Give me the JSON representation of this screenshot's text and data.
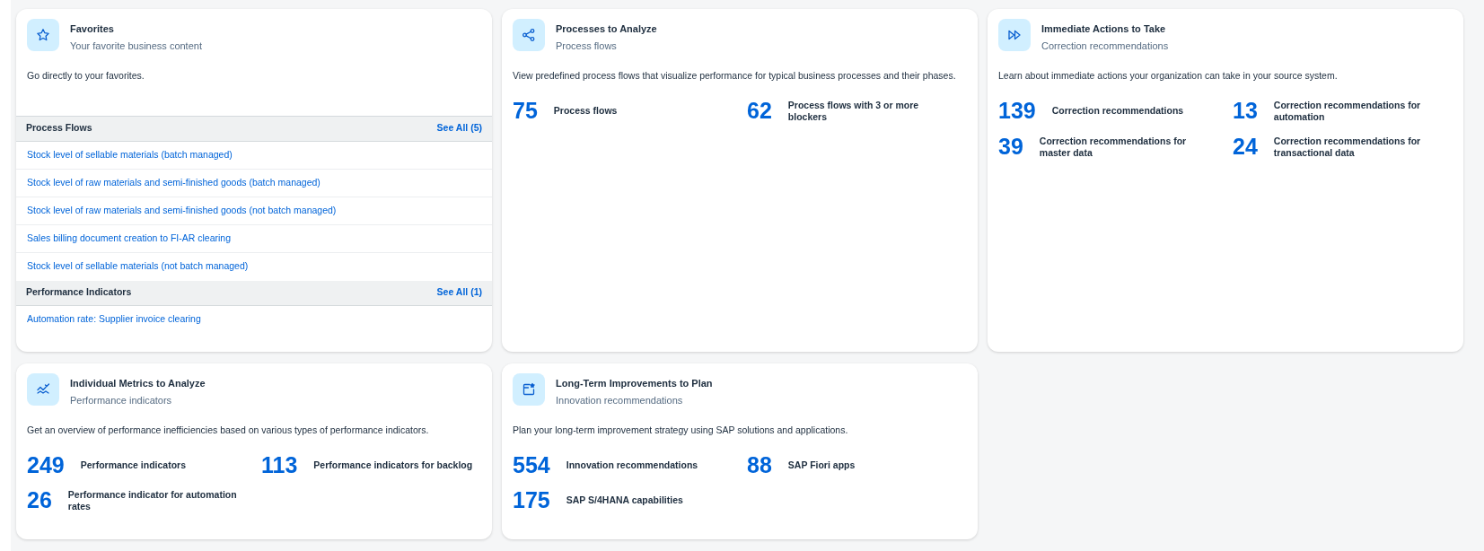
{
  "cards": [
    {
      "kind": "star",
      "title": "Favorites",
      "subtitle": "Your favorite business content",
      "description": "Go directly to your favorites.",
      "sections": [
        {
          "title": "Process Flows",
          "see_all": "See All (5)",
          "items": [
            "Stock level of sellable materials (batch managed)",
            "Stock level of raw materials and semi-finished goods (batch managed)",
            "Stock level of raw materials and semi-finished goods (not batch managed)",
            "Sales billing document creation to FI-AR clearing",
            "Stock level of sellable materials (not batch managed)"
          ]
        },
        {
          "title": "Performance Indicators",
          "see_all": "See All (1)",
          "items": [
            "Automation rate: Supplier invoice clearing"
          ]
        }
      ]
    },
    {
      "kind": "share",
      "title": "Processes to Analyze",
      "subtitle": "Process flows",
      "description": "View predefined process flows that visualize performance for typical business processes and their phases.",
      "stats": [
        {
          "value": "75",
          "label": "Process flows"
        },
        {
          "value": "62",
          "label": "Process flows with 3 or more blockers"
        }
      ]
    },
    {
      "kind": "forward",
      "title": "Immediate Actions to Take",
      "subtitle": "Correction recommendations",
      "description": "Learn about immediate actions your organization can take in your source system.",
      "stats": [
        {
          "value": "139",
          "label": "Correction recommendations"
        },
        {
          "value": "13",
          "label": "Correction recommendations for automation"
        },
        {
          "value": "39",
          "label": "Correction recommendations for master data"
        },
        {
          "value": "24",
          "label": "Correction recommendations for transactional data"
        }
      ]
    },
    {
      "kind": "chart",
      "title": "Individual Metrics to Analyze",
      "subtitle": "Performance indicators",
      "description": "Get an overview of performance inefficiencies based on various types of performance indicators.",
      "stats": [
        {
          "value": "249",
          "label": "Performance indicators"
        },
        {
          "value": "113",
          "label": "Performance indicators for backlog"
        },
        {
          "value": "26",
          "label": "Performance indicator for automation rates"
        }
      ]
    },
    {
      "kind": "app",
      "title": "Long-Term Improvements to Plan",
      "subtitle": "Innovation recommendations",
      "description": "Plan your long-term improvement strategy using SAP solutions and applications.",
      "stats": [
        {
          "value": "554",
          "label": "Innovation recommendations"
        },
        {
          "value": "88",
          "label": "SAP Fiori apps"
        },
        {
          "value": "175",
          "label": "SAP S/4HANA capabilities"
        }
      ]
    }
  ]
}
